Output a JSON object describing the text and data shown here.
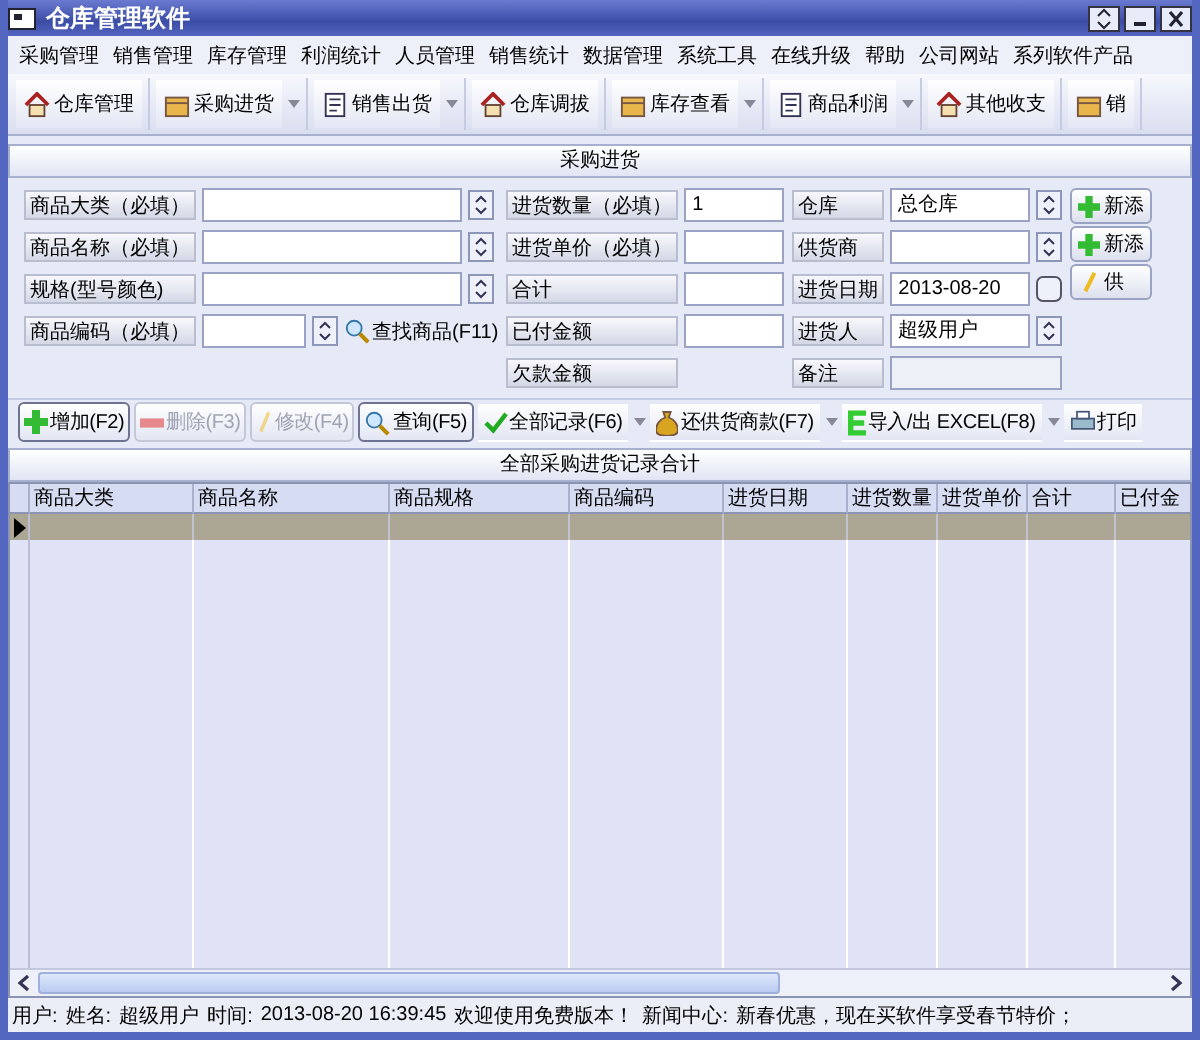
{
  "window": {
    "title": "仓库管理软件"
  },
  "menu": [
    "采购管理",
    "销售管理",
    "库存管理",
    "利润统计",
    "人员管理",
    "销售统计",
    "数据管理",
    "系统工具",
    "在线升级",
    "帮助",
    "公司网站",
    "系列软件产品"
  ],
  "toolbar": [
    {
      "label": "仓库管理",
      "dropdown": false
    },
    {
      "label": "采购进货",
      "dropdown": true
    },
    {
      "label": "销售出货",
      "dropdown": true
    },
    {
      "label": "仓库调拔",
      "dropdown": false
    },
    {
      "label": "库存查看",
      "dropdown": true
    },
    {
      "label": "商品利润",
      "dropdown": true
    },
    {
      "label": "其他收支",
      "dropdown": false
    },
    {
      "label": "销",
      "dropdown": false
    }
  ],
  "panel_title": "采购进货",
  "left_fields": [
    {
      "label": "商品大类（必填）",
      "kind": "combo"
    },
    {
      "label": "商品名称（必填）",
      "kind": "combo"
    },
    {
      "label": "规格(型号颜色)",
      "kind": "combo"
    },
    {
      "label": "商品编码（必填）",
      "kind": "search",
      "link": "查找商品(F11)"
    }
  ],
  "middle_fields": [
    {
      "label": "进货数量（必填）",
      "kind": "text",
      "value": "1"
    },
    {
      "label": "进货单价（必填）",
      "kind": "text"
    },
    {
      "label": "合计",
      "kind": "text"
    },
    {
      "label": "已付金额",
      "kind": "text"
    },
    {
      "label": "欠款金额",
      "kind": "none"
    }
  ],
  "right_fields": [
    {
      "label": "仓库",
      "kind": "combo",
      "value": "总仓库"
    },
    {
      "label": "供货商",
      "kind": "combo"
    },
    {
      "label": "进货日期",
      "kind": "date",
      "value": "2013-08-20"
    },
    {
      "label": "进货人",
      "kind": "combo",
      "value": "超级用户"
    },
    {
      "label": "备注",
      "kind": "readonly"
    }
  ],
  "side_buttons": [
    {
      "label": "新添",
      "kind": "add"
    },
    {
      "label": "新添",
      "kind": "add"
    },
    {
      "label": "供",
      "kind": "edit"
    }
  ],
  "actions": [
    {
      "label": "增加(F2)",
      "kind": "add",
      "disabled": false,
      "dropdown": false
    },
    {
      "label": "删除(F3)",
      "kind": "delete",
      "disabled": true,
      "dropdown": false
    },
    {
      "label": "修改(F4)",
      "kind": "edit",
      "disabled": true,
      "dropdown": false
    },
    {
      "label": "查询(F5)",
      "kind": "search",
      "disabled": false,
      "dropdown": false
    },
    {
      "label": "全部记录(F6)",
      "kind": "check",
      "disabled": false,
      "dropdown": true
    },
    {
      "label": "还供货商款(F7)",
      "kind": "money",
      "disabled": false,
      "dropdown": true
    },
    {
      "label": "导入/出 EXCEL(F8)",
      "kind": "excel",
      "disabled": false,
      "dropdown": true
    },
    {
      "label": "打印",
      "kind": "print",
      "disabled": false,
      "dropdown": false
    }
  ],
  "table": {
    "title": "全部采购进货记录合计",
    "columns": [
      "商品大类",
      "商品名称",
      "商品规格",
      "商品编码",
      "进货日期",
      "进货数量",
      "进货单价",
      "合计",
      "已付金"
    ],
    "rows": [
      {
        "selected": true
      }
    ]
  },
  "status_bar": [
    {
      "label": "用户:"
    },
    {
      "label": "姓名:",
      "value": "超级用户"
    },
    {
      "label": "时间:",
      "value": "2013-08-20 16:39:45"
    },
    {
      "label": "欢迎使用免费版本！"
    },
    {
      "label": "新闻中心:",
      "value": "新春优惠，现在买软件享受春节特价；"
    }
  ]
}
